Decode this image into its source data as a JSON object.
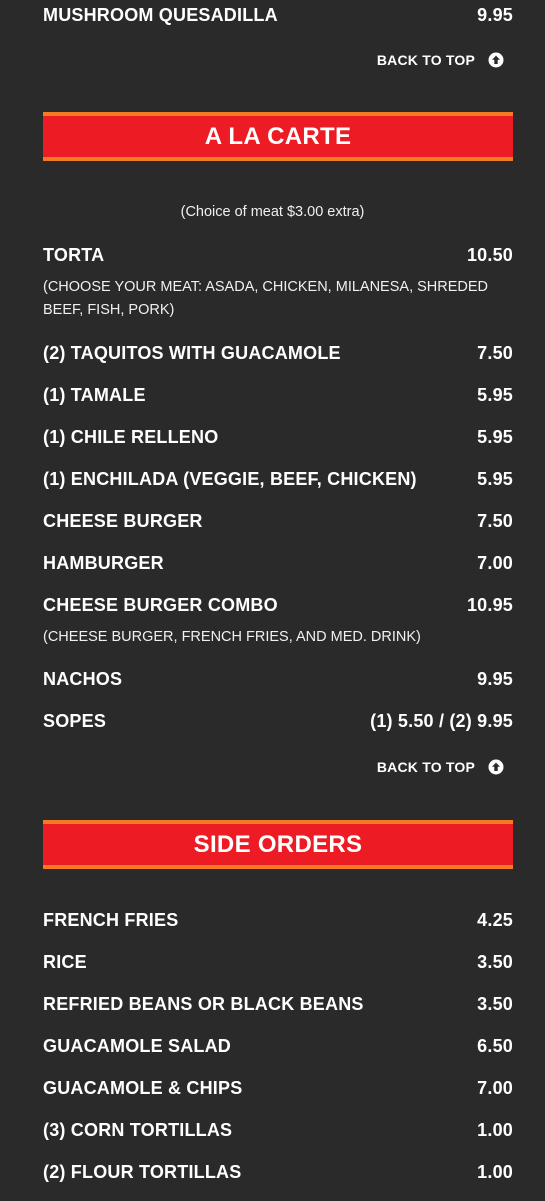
{
  "top_item": {
    "name": "MUSHROOM QUESADILLA",
    "price": "9.95"
  },
  "back_to_top": {
    "label": "BACK TO TOP",
    "icon": "arrow-circle-up-icon"
  },
  "a_la_carte": {
    "title": "A LA CARTE",
    "note": "(Choice of meat $3.00 extra)",
    "items": [
      {
        "name": "TORTA",
        "price": "10.50",
        "desc": "(CHOOSE YOUR MEAT: ASADA, CHICKEN, MILANESA, SHREDED BEEF, FISH, PORK)"
      },
      {
        "name": "(2) TAQUITOS WITH GUACAMOLE",
        "price": "7.50"
      },
      {
        "name": "(1) TAMALE",
        "price": "5.95"
      },
      {
        "name": "(1) CHILE RELLENO",
        "price": "5.95"
      },
      {
        "name": "(1) ENCHILADA (VEGGIE, BEEF, CHICKEN)",
        "price": "5.95"
      },
      {
        "name": "CHEESE BURGER",
        "price": "7.50"
      },
      {
        "name": "HAMBURGER",
        "price": "7.00"
      },
      {
        "name": "CHEESE BURGER COMBO",
        "price": "10.95",
        "desc": "(CHEESE BURGER, FRENCH FRIES, AND MED. DRINK)"
      },
      {
        "name": "NACHOS",
        "price": "9.95"
      },
      {
        "name": "SOPES",
        "price": "(1) 5.50 / (2) 9.95"
      }
    ]
  },
  "side_orders": {
    "title": "SIDE ORDERS",
    "items": [
      {
        "name": "FRENCH FRIES",
        "price": "4.25"
      },
      {
        "name": "RICE",
        "price": "3.50"
      },
      {
        "name": "REFRIED BEANS OR BLACK BEANS",
        "price": "3.50"
      },
      {
        "name": "GUACAMOLE SALAD",
        "price": "6.50"
      },
      {
        "name": "GUACAMOLE & CHIPS",
        "price": "7.00"
      },
      {
        "name": "(3) CORN TORTILLAS",
        "price": "1.00"
      },
      {
        "name": "(2) FLOUR TORTILLAS",
        "price": "1.00"
      }
    ]
  },
  "colors": {
    "background": "#2a2a2a",
    "banner_red": "#ed1c24",
    "banner_border_orange": "#f47b20",
    "text": "#ffffff"
  }
}
